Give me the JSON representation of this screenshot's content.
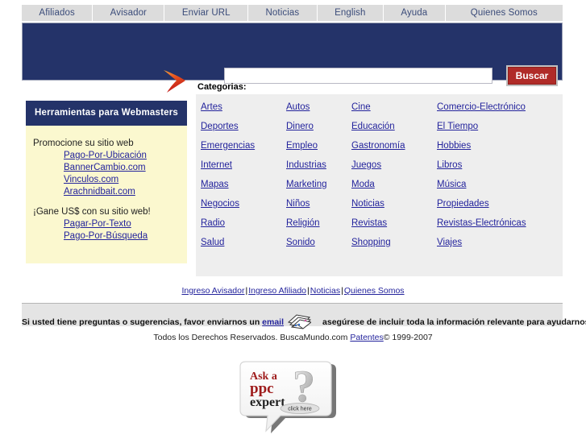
{
  "nav": {
    "tabs": [
      {
        "label": "Afiliados"
      },
      {
        "label": "Avisador"
      },
      {
        "label": "Enviar URL"
      },
      {
        "label": "Noticias"
      },
      {
        "label": "English"
      },
      {
        "label": "Ayuda"
      },
      {
        "label": "Quienes Somos"
      }
    ]
  },
  "search": {
    "value": "",
    "placeholder": "",
    "button_label": "Buscar",
    "logo_icon": "boomerang-arrow-icon"
  },
  "sidebar": {
    "header": "Herramientas para Webmasters",
    "section1": {
      "heading": "Promocione su sitio web",
      "links": [
        "Pago-Por-Ubicación",
        "BannerCambio.com",
        "Vinculos.com",
        "Arachnidbait.com"
      ]
    },
    "section2": {
      "heading": "¡Gane US$ con su sitio web!",
      "links": [
        "Pagar-Por-Texto",
        "Pago-Por-Búsqueda"
      ]
    }
  },
  "categories": {
    "title": "Categorias:",
    "items": [
      "Artes",
      "Autos",
      "Cine",
      "Comercio-Electrónico",
      "Deportes",
      "Dinero",
      "Educación",
      "El Tiempo",
      "Emergencias",
      "Empleo",
      "Gastronomía",
      "Hobbies",
      "Internet",
      "Industrias",
      "Juegos",
      "Libros",
      "Mapas",
      "Marketing",
      "Moda",
      "Música",
      "Negocios",
      "Niños",
      "Noticias",
      "Propiedades",
      "Radio",
      "Religión",
      "Revistas",
      "Revistas-Electrónicas",
      "Salud",
      "Sonido",
      "Shopping",
      "Viajes"
    ]
  },
  "midlinks": {
    "items": [
      "Ingreso Avisador",
      "Ingreso Afiliado",
      "Noticias",
      "Quienes Somos"
    ],
    "separator": "|"
  },
  "footer": {
    "contact_before": "Si usted tiene preguntas o sugerencias, favor enviarnos un ",
    "contact_link": "email",
    "contact_after": "asegúrese de incluir toda la información relevante para ayudarnos a servirle mejor.",
    "mail_icon": "envelopes-icon",
    "copyright_before": "Todos los Derechos Reservados. BuscaMundo.com ",
    "copyright_link": "Patentes",
    "copyright_after": "© 1999-2007"
  },
  "ad": {
    "line1": "Ask a",
    "line2": "ppc",
    "line3": "expert",
    "cta": "click here",
    "mark": "?"
  },
  "colors": {
    "navy": "#243369",
    "tab_gray": "#dcdcdc",
    "tab_text": "#3b4c7a",
    "link_blue": "#23239c",
    "sidebar_yellow": "#fbf8cf",
    "panel_gray": "#eeeeee",
    "button_red": "#b02b28",
    "footer_gray": "#e4e4e4"
  }
}
